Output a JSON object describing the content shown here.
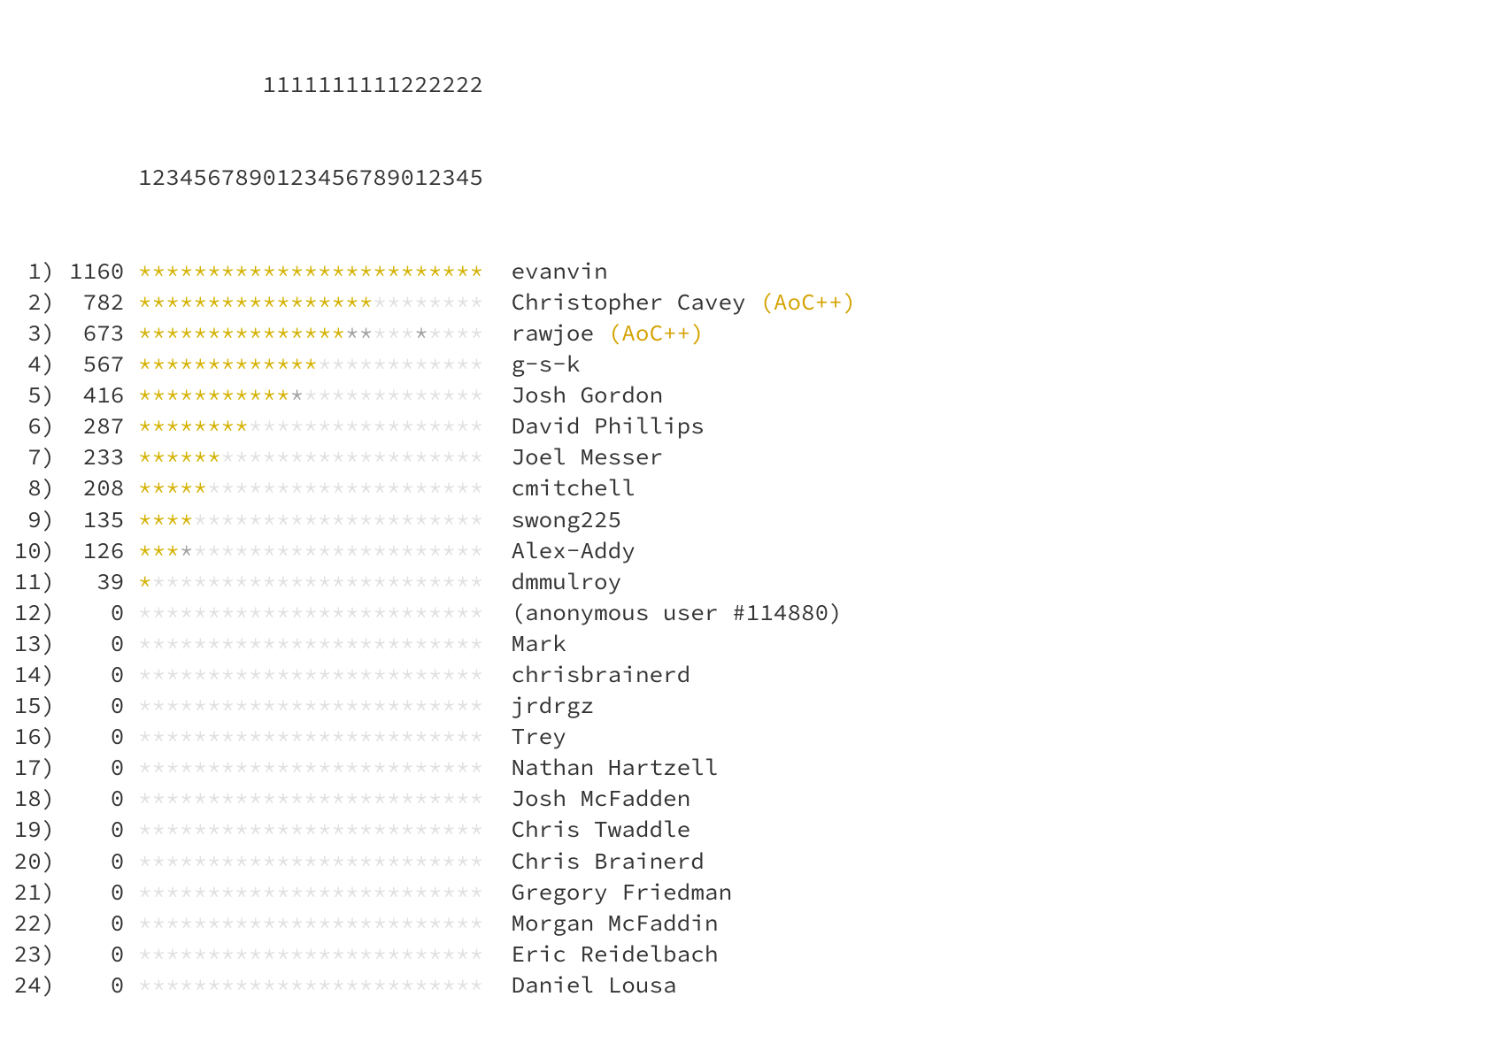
{
  "header": {
    "line1_prefix": "          ",
    "line1_digits": "         1111111111222222",
    "line2_prefix": "          ",
    "line2_digits": "1234567890123456789012345"
  },
  "rows": [
    {
      "rank": "1",
      "score": "1160",
      "stars": [
        "g",
        "g",
        "g",
        "g",
        "g",
        "g",
        "g",
        "g",
        "g",
        "g",
        "g",
        "g",
        "g",
        "g",
        "g",
        "g",
        "g",
        "g",
        "g",
        "g",
        "g",
        "g",
        "g",
        "g",
        "g"
      ],
      "name": "evanvin",
      "supporter": ""
    },
    {
      "rank": "2",
      "score": "782",
      "stars": [
        "g",
        "g",
        "g",
        "g",
        "g",
        "g",
        "g",
        "g",
        "g",
        "g",
        "g",
        "g",
        "g",
        "g",
        "g",
        "g",
        "g",
        "n",
        "n",
        "n",
        "n",
        "n",
        "n",
        "n",
        "n"
      ],
      "name": "Christopher Cavey",
      "supporter": "(AoC++)"
    },
    {
      "rank": "3",
      "score": "673",
      "stars": [
        "g",
        "g",
        "g",
        "g",
        "g",
        "g",
        "g",
        "g",
        "g",
        "g",
        "g",
        "g",
        "g",
        "g",
        "g",
        "s",
        "s",
        "n",
        "n",
        "n",
        "s",
        "n",
        "n",
        "n",
        "n"
      ],
      "name": "rawjoe",
      "supporter": "(AoC++)"
    },
    {
      "rank": "4",
      "score": "567",
      "stars": [
        "g",
        "g",
        "g",
        "g",
        "g",
        "g",
        "g",
        "g",
        "g",
        "g",
        "g",
        "g",
        "g",
        "n",
        "n",
        "n",
        "n",
        "n",
        "n",
        "n",
        "n",
        "n",
        "n",
        "n",
        "n"
      ],
      "name": "g-s-k",
      "supporter": ""
    },
    {
      "rank": "5",
      "score": "416",
      "stars": [
        "g",
        "g",
        "g",
        "g",
        "g",
        "g",
        "g",
        "g",
        "g",
        "g",
        "g",
        "s",
        "n",
        "n",
        "n",
        "n",
        "n",
        "n",
        "n",
        "n",
        "n",
        "n",
        "n",
        "n",
        "n"
      ],
      "name": "Josh Gordon",
      "supporter": ""
    },
    {
      "rank": "6",
      "score": "287",
      "stars": [
        "g",
        "g",
        "g",
        "g",
        "g",
        "g",
        "g",
        "g",
        "n",
        "n",
        "n",
        "n",
        "n",
        "n",
        "n",
        "n",
        "n",
        "n",
        "n",
        "n",
        "n",
        "n",
        "n",
        "n",
        "n"
      ],
      "name": "David Phillips",
      "supporter": ""
    },
    {
      "rank": "7",
      "score": "233",
      "stars": [
        "g",
        "g",
        "g",
        "g",
        "g",
        "g",
        "n",
        "n",
        "n",
        "n",
        "n",
        "n",
        "n",
        "n",
        "n",
        "n",
        "n",
        "n",
        "n",
        "n",
        "n",
        "n",
        "n",
        "n",
        "n"
      ],
      "name": "Joel Messer",
      "supporter": ""
    },
    {
      "rank": "8",
      "score": "208",
      "stars": [
        "g",
        "g",
        "g",
        "g",
        "g",
        "n",
        "n",
        "n",
        "n",
        "n",
        "n",
        "n",
        "n",
        "n",
        "n",
        "n",
        "n",
        "n",
        "n",
        "n",
        "n",
        "n",
        "n",
        "n",
        "n"
      ],
      "name": "cmitchell",
      "supporter": ""
    },
    {
      "rank": "9",
      "score": "135",
      "stars": [
        "g",
        "g",
        "g",
        "g",
        "n",
        "n",
        "n",
        "n",
        "n",
        "n",
        "n",
        "n",
        "n",
        "n",
        "n",
        "n",
        "n",
        "n",
        "n",
        "n",
        "n",
        "n",
        "n",
        "n",
        "n"
      ],
      "name": "swong225",
      "supporter": ""
    },
    {
      "rank": "10",
      "score": "126",
      "stars": [
        "g",
        "g",
        "g",
        "s",
        "n",
        "n",
        "n",
        "n",
        "n",
        "n",
        "n",
        "n",
        "n",
        "n",
        "n",
        "n",
        "n",
        "n",
        "n",
        "n",
        "n",
        "n",
        "n",
        "n",
        "n"
      ],
      "name": "Alex-Addy",
      "supporter": ""
    },
    {
      "rank": "11",
      "score": "39",
      "stars": [
        "g",
        "n",
        "n",
        "n",
        "n",
        "n",
        "n",
        "n",
        "n",
        "n",
        "n",
        "n",
        "n",
        "n",
        "n",
        "n",
        "n",
        "n",
        "n",
        "n",
        "n",
        "n",
        "n",
        "n",
        "n"
      ],
      "name": "dmmulroy",
      "supporter": ""
    },
    {
      "rank": "12",
      "score": "0",
      "stars": [
        "n",
        "n",
        "n",
        "n",
        "n",
        "n",
        "n",
        "n",
        "n",
        "n",
        "n",
        "n",
        "n",
        "n",
        "n",
        "n",
        "n",
        "n",
        "n",
        "n",
        "n",
        "n",
        "n",
        "n",
        "n"
      ],
      "name": "(anonymous user #114880)",
      "supporter": ""
    },
    {
      "rank": "13",
      "score": "0",
      "stars": [
        "n",
        "n",
        "n",
        "n",
        "n",
        "n",
        "n",
        "n",
        "n",
        "n",
        "n",
        "n",
        "n",
        "n",
        "n",
        "n",
        "n",
        "n",
        "n",
        "n",
        "n",
        "n",
        "n",
        "n",
        "n"
      ],
      "name": "Mark",
      "supporter": ""
    },
    {
      "rank": "14",
      "score": "0",
      "stars": [
        "n",
        "n",
        "n",
        "n",
        "n",
        "n",
        "n",
        "n",
        "n",
        "n",
        "n",
        "n",
        "n",
        "n",
        "n",
        "n",
        "n",
        "n",
        "n",
        "n",
        "n",
        "n",
        "n",
        "n",
        "n"
      ],
      "name": "chrisbrainerd",
      "supporter": ""
    },
    {
      "rank": "15",
      "score": "0",
      "stars": [
        "n",
        "n",
        "n",
        "n",
        "n",
        "n",
        "n",
        "n",
        "n",
        "n",
        "n",
        "n",
        "n",
        "n",
        "n",
        "n",
        "n",
        "n",
        "n",
        "n",
        "n",
        "n",
        "n",
        "n",
        "n"
      ],
      "name": "jrdrgz",
      "supporter": ""
    },
    {
      "rank": "16",
      "score": "0",
      "stars": [
        "n",
        "n",
        "n",
        "n",
        "n",
        "n",
        "n",
        "n",
        "n",
        "n",
        "n",
        "n",
        "n",
        "n",
        "n",
        "n",
        "n",
        "n",
        "n",
        "n",
        "n",
        "n",
        "n",
        "n",
        "n"
      ],
      "name": "Trey",
      "supporter": ""
    },
    {
      "rank": "17",
      "score": "0",
      "stars": [
        "n",
        "n",
        "n",
        "n",
        "n",
        "n",
        "n",
        "n",
        "n",
        "n",
        "n",
        "n",
        "n",
        "n",
        "n",
        "n",
        "n",
        "n",
        "n",
        "n",
        "n",
        "n",
        "n",
        "n",
        "n"
      ],
      "name": "Nathan Hartzell",
      "supporter": ""
    },
    {
      "rank": "18",
      "score": "0",
      "stars": [
        "n",
        "n",
        "n",
        "n",
        "n",
        "n",
        "n",
        "n",
        "n",
        "n",
        "n",
        "n",
        "n",
        "n",
        "n",
        "n",
        "n",
        "n",
        "n",
        "n",
        "n",
        "n",
        "n",
        "n",
        "n"
      ],
      "name": "Josh McFadden",
      "supporter": ""
    },
    {
      "rank": "19",
      "score": "0",
      "stars": [
        "n",
        "n",
        "n",
        "n",
        "n",
        "n",
        "n",
        "n",
        "n",
        "n",
        "n",
        "n",
        "n",
        "n",
        "n",
        "n",
        "n",
        "n",
        "n",
        "n",
        "n",
        "n",
        "n",
        "n",
        "n"
      ],
      "name": "Chris Twaddle",
      "supporter": ""
    },
    {
      "rank": "20",
      "score": "0",
      "stars": [
        "n",
        "n",
        "n",
        "n",
        "n",
        "n",
        "n",
        "n",
        "n",
        "n",
        "n",
        "n",
        "n",
        "n",
        "n",
        "n",
        "n",
        "n",
        "n",
        "n",
        "n",
        "n",
        "n",
        "n",
        "n"
      ],
      "name": "Chris Brainerd",
      "supporter": ""
    },
    {
      "rank": "21",
      "score": "0",
      "stars": [
        "n",
        "n",
        "n",
        "n",
        "n",
        "n",
        "n",
        "n",
        "n",
        "n",
        "n",
        "n",
        "n",
        "n",
        "n",
        "n",
        "n",
        "n",
        "n",
        "n",
        "n",
        "n",
        "n",
        "n",
        "n"
      ],
      "name": "Gregory Friedman",
      "supporter": ""
    },
    {
      "rank": "22",
      "score": "0",
      "stars": [
        "n",
        "n",
        "n",
        "n",
        "n",
        "n",
        "n",
        "n",
        "n",
        "n",
        "n",
        "n",
        "n",
        "n",
        "n",
        "n",
        "n",
        "n",
        "n",
        "n",
        "n",
        "n",
        "n",
        "n",
        "n"
      ],
      "name": "Morgan McFaddin",
      "supporter": ""
    },
    {
      "rank": "23",
      "score": "0",
      "stars": [
        "n",
        "n",
        "n",
        "n",
        "n",
        "n",
        "n",
        "n",
        "n",
        "n",
        "n",
        "n",
        "n",
        "n",
        "n",
        "n",
        "n",
        "n",
        "n",
        "n",
        "n",
        "n",
        "n",
        "n",
        "n"
      ],
      "name": "Eric Reidelbach",
      "supporter": ""
    },
    {
      "rank": "24",
      "score": "0",
      "stars": [
        "n",
        "n",
        "n",
        "n",
        "n",
        "n",
        "n",
        "n",
        "n",
        "n",
        "n",
        "n",
        "n",
        "n",
        "n",
        "n",
        "n",
        "n",
        "n",
        "n",
        "n",
        "n",
        "n",
        "n",
        "n"
      ],
      "name": "Daniel Lousa",
      "supporter": ""
    }
  ]
}
